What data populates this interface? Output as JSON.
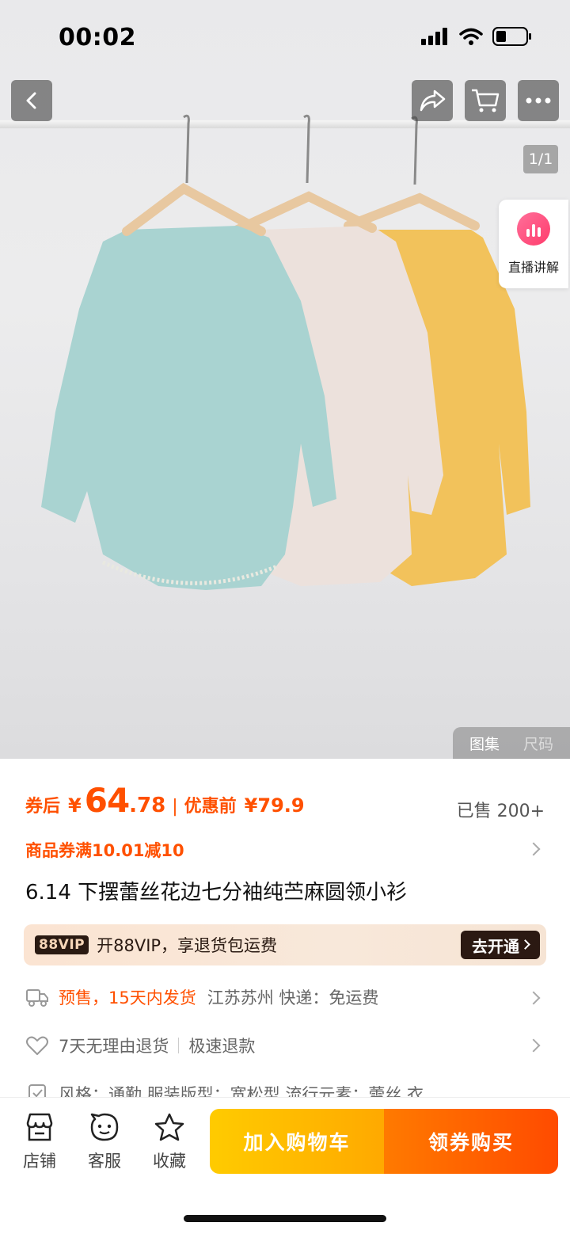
{
  "status_bar": {
    "time": "00:02",
    "battery_level": 0.35
  },
  "nav": {
    "back_icon": "chevron-left-icon",
    "share_icon": "share-icon",
    "cart_icon": "cart-icon",
    "more_icon": "more-icon"
  },
  "gallery": {
    "counter": "1/1",
    "live_label": "直播讲解",
    "tabs": [
      "图集",
      "尺码"
    ],
    "shirt_colors": [
      "#a9d4d2",
      "#ede2dc",
      "#f2c25b"
    ]
  },
  "price": {
    "after_label": "券后",
    "currency": "¥",
    "after_int": "64",
    "after_dec": ".78",
    "separator": "|",
    "before_label": "优惠前",
    "before_value": "¥79.9",
    "sold": "已售 200+"
  },
  "coupon": {
    "text": "商品券满10.01减10"
  },
  "product": {
    "title": "6.14 下摆蕾丝花边七分袖纯苎麻圆领小衫"
  },
  "vip": {
    "badge": "88VIP",
    "text": "开88VIP，享退货包运费",
    "button": "去开通"
  },
  "shipping": {
    "presale": "预售，15天内发货",
    "rest": "江苏苏州  快递：免运费"
  },
  "returns": {
    "policy": "7天无理由退货",
    "refund": "极速退款"
  },
  "params": {
    "text": "风格：通勤  服装版型：宽松型  流行元素：蕾丝  衣"
  },
  "bottom": {
    "store": "店铺",
    "service": "客服",
    "favorite": "收藏",
    "add_cart": "加入购物车",
    "buy": "领券购买"
  },
  "colors": {
    "accent": "#ff5000",
    "cart_button": "#ffb800",
    "buy_button": "#ff5a00"
  }
}
